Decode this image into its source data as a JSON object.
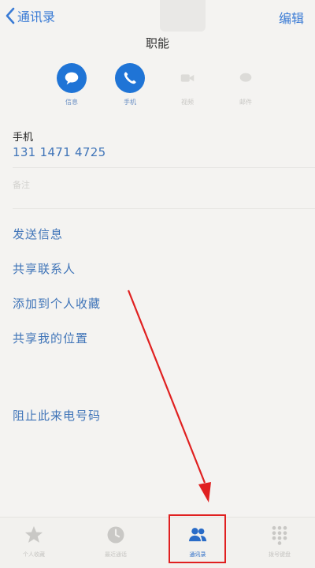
{
  "nav": {
    "back_label": "通讯录",
    "edit_label": "编辑"
  },
  "contact": {
    "name": "职能"
  },
  "actions": [
    {
      "label": "信息",
      "icon": "message-icon",
      "active": true
    },
    {
      "label": "手机",
      "icon": "phone-icon",
      "active": true
    },
    {
      "label": "视频",
      "icon": "video-icon",
      "active": false
    },
    {
      "label": "邮件",
      "icon": "mail-icon",
      "active": false
    }
  ],
  "phone": {
    "label": "手机",
    "number": "131 1471 4725"
  },
  "notes_label": "备注",
  "rows": {
    "send_message": "发送信息",
    "share_contact": "共享联系人",
    "add_favorite": "添加到个人收藏",
    "share_location": "共享我的位置",
    "block_caller": "阻止此来电号码"
  },
  "tabs": [
    {
      "label": "个人收藏",
      "icon": "star-icon",
      "active": false
    },
    {
      "label": "最近通话",
      "icon": "clock-icon",
      "active": false
    },
    {
      "label": "通讯录",
      "icon": "contacts-icon",
      "active": true
    },
    {
      "label": "拨号键盘",
      "icon": "keypad-icon",
      "active": false
    }
  ],
  "colors": {
    "accent": "#1f74d6",
    "link": "#3f74b8",
    "annotation": "#e02020"
  }
}
